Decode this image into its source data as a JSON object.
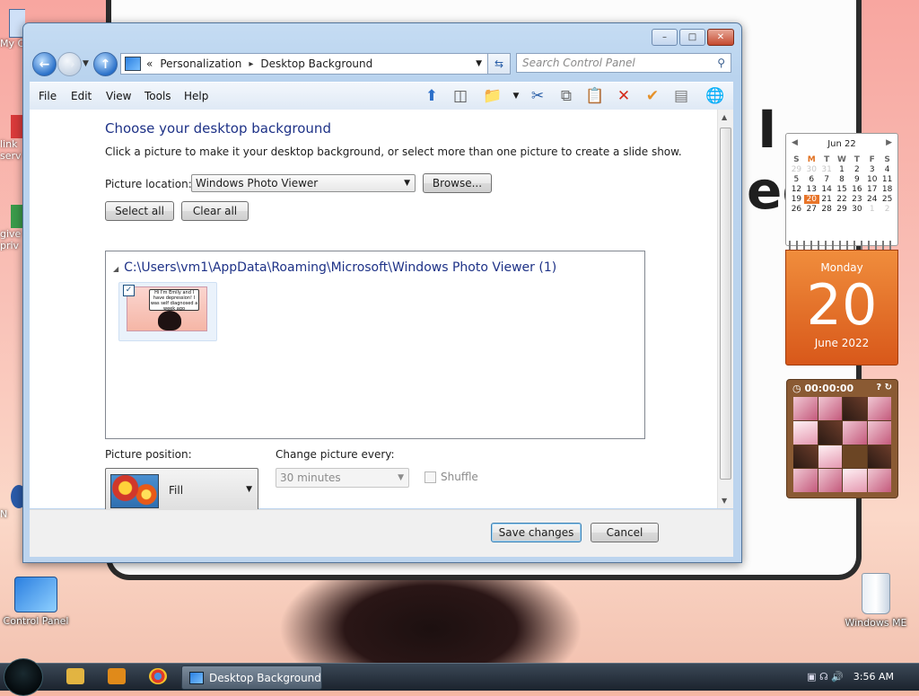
{
  "desktop": {
    "wallpaper_text": [
      "I",
      "ed"
    ],
    "icons_left": [
      {
        "label": "My C"
      },
      {
        "label": "link\nserv"
      },
      {
        "label": "give\npriv"
      },
      {
        "label": "N"
      }
    ],
    "control_panel_label": "Control Panel",
    "recycle_bin_label": "Windows ME"
  },
  "window": {
    "caption_buttons": {
      "minimize": "–",
      "maximize": "□",
      "close": "✕"
    },
    "breadcrumb": {
      "prefix": "«",
      "items": [
        "Personalization",
        "Desktop Background"
      ],
      "separator": "▸"
    },
    "search_placeholder": "Search Control Panel",
    "menu": [
      "File",
      "Edit",
      "View",
      "Tools",
      "Help"
    ],
    "toolbar_icons": [
      "up-icon",
      "pane-icon",
      "folder-icon",
      "cut-icon",
      "copy-icon",
      "paste-icon",
      "delete-icon",
      "check-icon",
      "rename-icon",
      "globe-icon"
    ],
    "title": "Choose your desktop background",
    "subtitle": "Click a picture to make it your desktop background, or select more than one picture to create a slide show.",
    "picture_location_label": "Picture location:",
    "picture_location_value": "Windows Photo Viewer",
    "browse_label": "Browse...",
    "select_all_label": "Select all",
    "clear_all_label": "Clear all",
    "group_header": "C:\\Users\\vm1\\AppData\\Roaming\\Microsoft\\Windows Photo Viewer (1)",
    "thumbnail_card_text": "Hi I'm Emily and I have depression! I was self diagnosed a week ago",
    "thumbnail_checked": true,
    "picture_position_label": "Picture position:",
    "picture_position_value": "Fill",
    "change_picture_label": "Change picture every:",
    "change_picture_value": "30 minutes",
    "shuffle_label": "Shuffle",
    "save_label": "Save changes",
    "cancel_label": "Cancel"
  },
  "calendar_gadget": {
    "month_header": "Jun 22",
    "days_of_week": [
      "S",
      "M",
      "T",
      "W",
      "T",
      "F",
      "S"
    ],
    "weeks": [
      [
        "29",
        "30",
        "31",
        "1",
        "2",
        "3",
        "4"
      ],
      [
        "5",
        "6",
        "7",
        "8",
        "9",
        "10",
        "11"
      ],
      [
        "12",
        "13",
        "14",
        "15",
        "16",
        "17",
        "18"
      ],
      [
        "19",
        "20",
        "21",
        "22",
        "23",
        "24",
        "25"
      ],
      [
        "26",
        "27",
        "28",
        "29",
        "30",
        "1",
        "2"
      ]
    ],
    "today": "20",
    "day_name": "Monday",
    "day_number": "20",
    "month_year": "June 2022"
  },
  "puzzle_gadget": {
    "timer": "00:00:00",
    "buttons": "? ↻"
  },
  "taskbar": {
    "active_window": "Desktop Background",
    "clock": "3:56 AM"
  }
}
